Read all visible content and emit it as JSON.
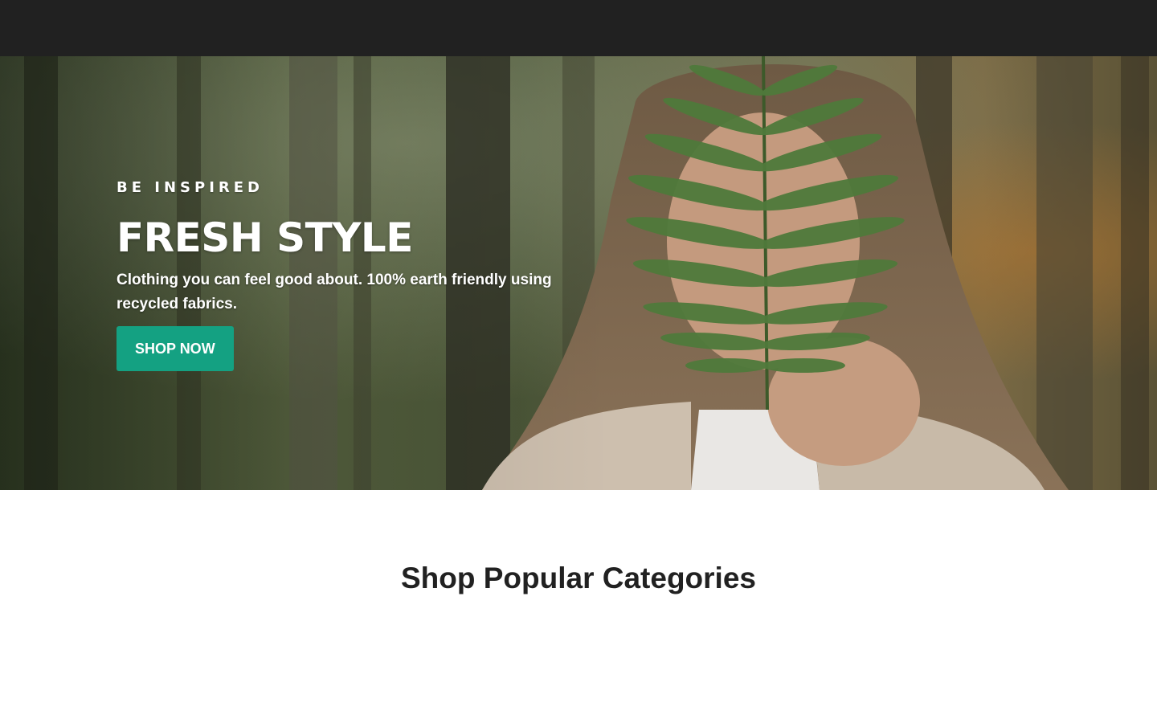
{
  "hero": {
    "eyebrow": "BE INSPIRED",
    "headline": "FRESH STYLE",
    "subtext": "Clothing you can feel good about. 100% earth friendly using recycled fabrics.",
    "cta_label": "SHOP NOW",
    "image_icon": "woman-holding-fern-photo"
  },
  "categories": {
    "title": "Shop Popular Categories"
  },
  "colors": {
    "topbar": "#212121",
    "accent": "#14a182",
    "heading_text": "#212121"
  }
}
